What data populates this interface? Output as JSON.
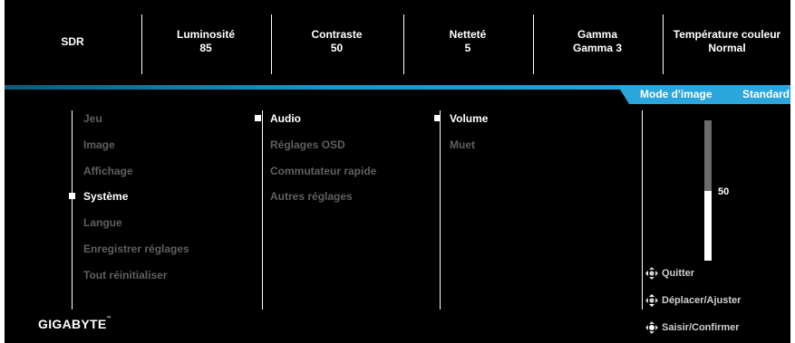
{
  "topbar": {
    "items": [
      {
        "title": "SDR",
        "value": ""
      },
      {
        "title": "Luminosité",
        "value": "85"
      },
      {
        "title": "Contraste",
        "value": "50"
      },
      {
        "title": "Netteté",
        "value": "5"
      },
      {
        "title": "Gamma",
        "value": "Gamma 3"
      },
      {
        "title": "Température couleur",
        "value": "Normal"
      }
    ]
  },
  "mode": {
    "label": "Mode d'image",
    "value": "Standard"
  },
  "menu": {
    "main": [
      "Jeu",
      "Image",
      "Affichage",
      "Système",
      "Langue",
      "Enregistrer réglages",
      "Tout réinitialiser"
    ],
    "main_active": "Système",
    "sub": [
      "Audio",
      "Réglages OSD",
      "Commutateur rapide",
      "Autres réglages"
    ],
    "sub_active": "Audio",
    "subsub": [
      "Volume",
      "Muet"
    ],
    "subsub_active": "Volume"
  },
  "slider": {
    "value": "50",
    "fraction": 0.5
  },
  "hints": {
    "quit": "Quitter",
    "move": "Déplacer/Ajuster",
    "enter": "Saisir/Confirmer"
  },
  "brand": {
    "logo": "GIGABYTE",
    "trademark": "™"
  },
  "colors": {
    "accent": "#2aa6dd",
    "inactive_text": "#5f5f5f",
    "background": "#000000"
  }
}
